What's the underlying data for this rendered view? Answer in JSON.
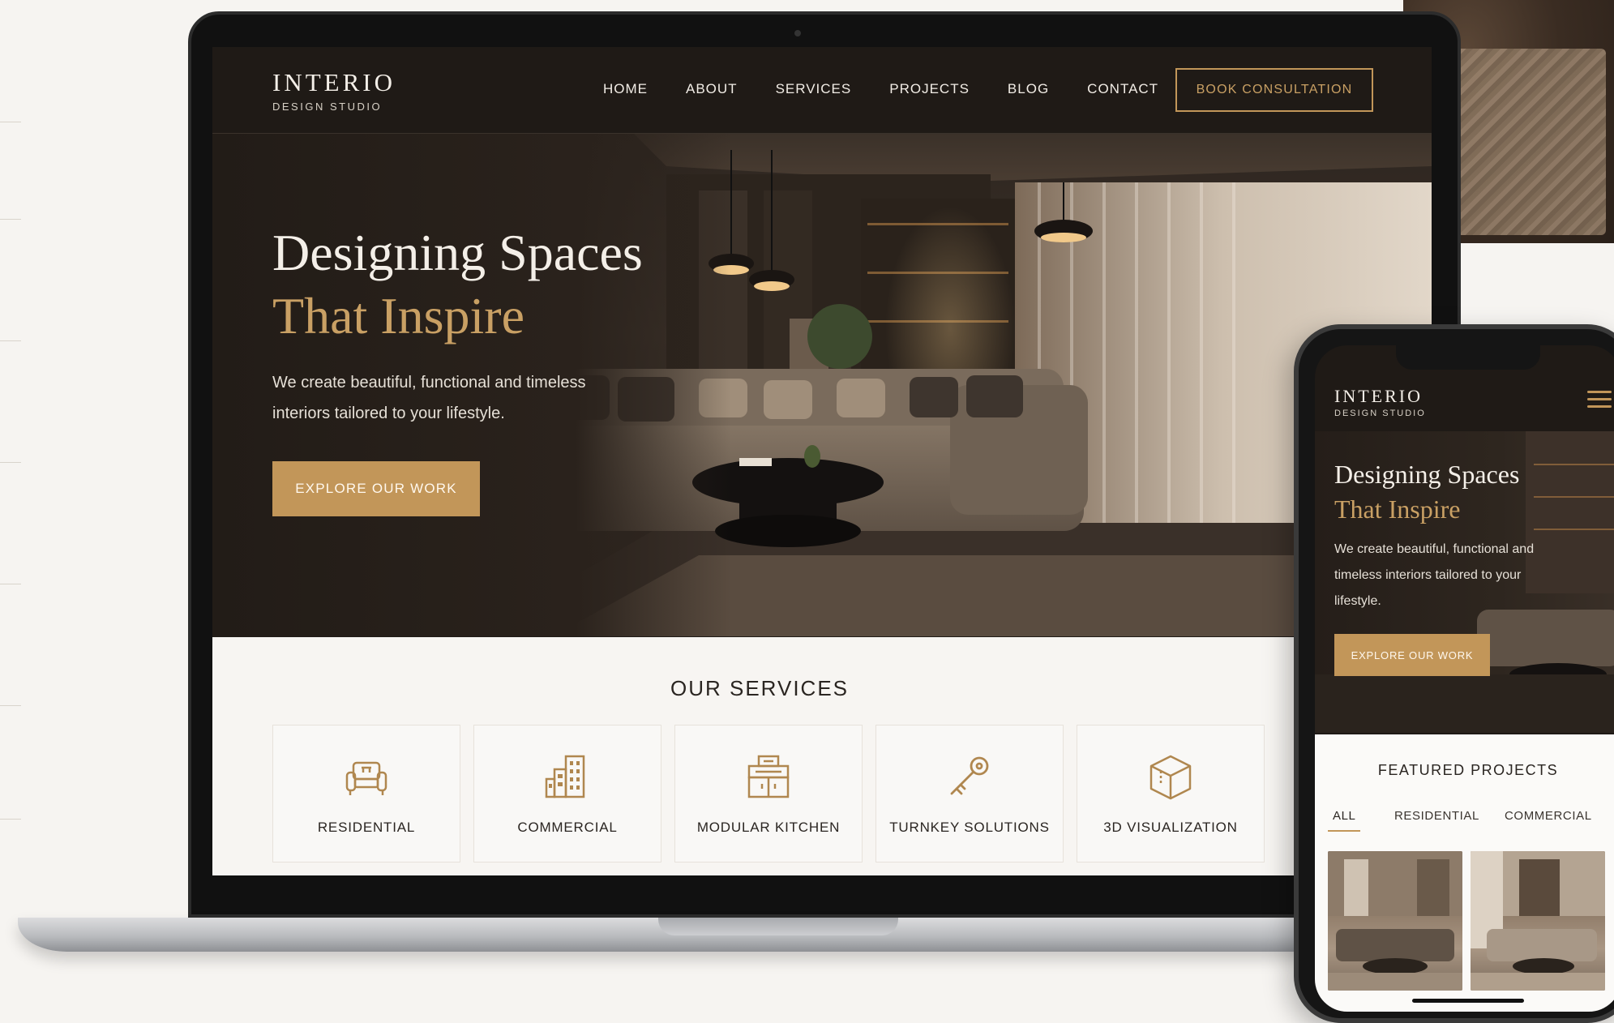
{
  "brand": {
    "name": "INTERIO",
    "tagline": "DESIGN STUDIO"
  },
  "nav": {
    "items": [
      {
        "label": "HOME"
      },
      {
        "label": "ABOUT"
      },
      {
        "label": "SERVICES"
      },
      {
        "label": "PROJECTS"
      },
      {
        "label": "BLOG"
      },
      {
        "label": "CONTACT"
      }
    ],
    "cta_label": "BOOK CONSULTATION"
  },
  "hero": {
    "title_line1": "Designing Spaces",
    "title_line2": "That Inspire",
    "subtitle": "We create beautiful, functional and timeless interiors tailored to your lifestyle.",
    "button_label": "EXPLORE OUR WORK"
  },
  "services": {
    "title": "OUR SERVICES",
    "items": [
      {
        "label": "RESIDENTIAL",
        "icon": "armchair-icon"
      },
      {
        "label": "COMMERCIAL",
        "icon": "building-icon"
      },
      {
        "label": "MODULAR KITCHEN",
        "icon": "kitchen-icon"
      },
      {
        "label": "TURNKEY SOLUTIONS",
        "icon": "key-icon"
      },
      {
        "label": "3D VISUALIZATION",
        "icon": "cube-icon"
      }
    ]
  },
  "mobile": {
    "brand_name": "INTERIO",
    "brand_tagline": "DESIGN STUDIO",
    "hero_title_line1": "Designing Spaces",
    "hero_title_line2": "That Inspire",
    "hero_subtitle": "We create beautiful, functional and timeless interiors tailored to your lifestyle.",
    "hero_button_label": "EXPLORE OUR WORK",
    "featured_title": "FEATURED PROJECTS",
    "tabs": [
      {
        "label": "ALL",
        "active": true
      },
      {
        "label": "RESIDENTIAL",
        "active": false
      },
      {
        "label": "COMMERCIAL",
        "active": false
      }
    ]
  },
  "colors": {
    "accent_gold": "#c29659",
    "dark_bg": "#1f1a16",
    "light_bg": "#f7f5f2"
  }
}
